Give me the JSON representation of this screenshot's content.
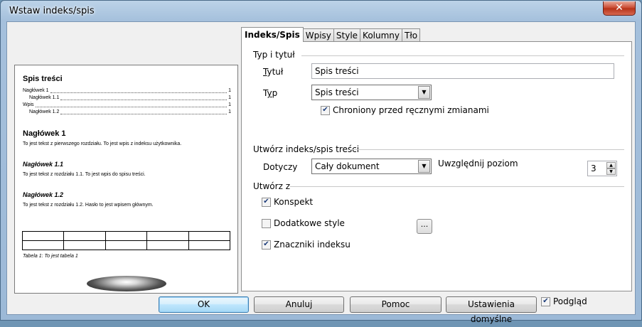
{
  "window": {
    "title": "Wstaw indeks/spis",
    "close_icon": "close-icon"
  },
  "preview": {
    "heading": "Spis treści",
    "toc": [
      {
        "text": "Nagłówek 1",
        "page": "1"
      },
      {
        "text": "Nagłówek 1.1",
        "page": "1"
      },
      {
        "text": "Wpis",
        "page": "1"
      },
      {
        "text": "Nagłówek 1.2",
        "page": "1"
      }
    ],
    "h1": "Nagłówek 1",
    "h1_text": "To jest tekst z pierwszego rozdziału. To jest wpis z indeksu użytkownika.",
    "h11": "Nagłówek 1.1",
    "h11_text": "To jest tekst z rozdziału 1.1. To jest wpis do spisu treści.",
    "h12": "Nagłówek 1.2",
    "h12_text": "To jest tekst z rozdziału 1.2. Hasło to jest wpisem głównym.",
    "caption": "Tabela 1: To jest tabela 1"
  },
  "tabs": [
    "Indeks/Spis",
    "Wpisy",
    "Style",
    "Kolumny",
    "Tło"
  ],
  "type_title": {
    "section": "Typ i tytuł",
    "title_label": "Tytuł",
    "title_value": "Spis treści",
    "type_label": "Typ",
    "type_value": "Spis treści",
    "protected_label": "Chroniony przed ręcznymi zmianami",
    "protected_checked": true
  },
  "create_index": {
    "section": "Utwórz indeks/spis treści",
    "applies_label": "Dotyczy",
    "applies_value": "Cały dokument",
    "level_label": "Uwzględnij poziom",
    "level_value": "3"
  },
  "create_from": {
    "section": "Utwórz z",
    "outline_label": "Konspekt",
    "outline_checked": true,
    "styles_label": "Dodatkowe style",
    "styles_checked": false,
    "styles_button": "...",
    "marks_label": "Znaczniki indeksu",
    "marks_checked": true
  },
  "buttons": {
    "ok": "OK",
    "cancel": "Anuluj",
    "help": "Pomoc",
    "defaults": "Ustawienia domyślne",
    "preview_label": "Podgląd",
    "preview_checked": true
  }
}
